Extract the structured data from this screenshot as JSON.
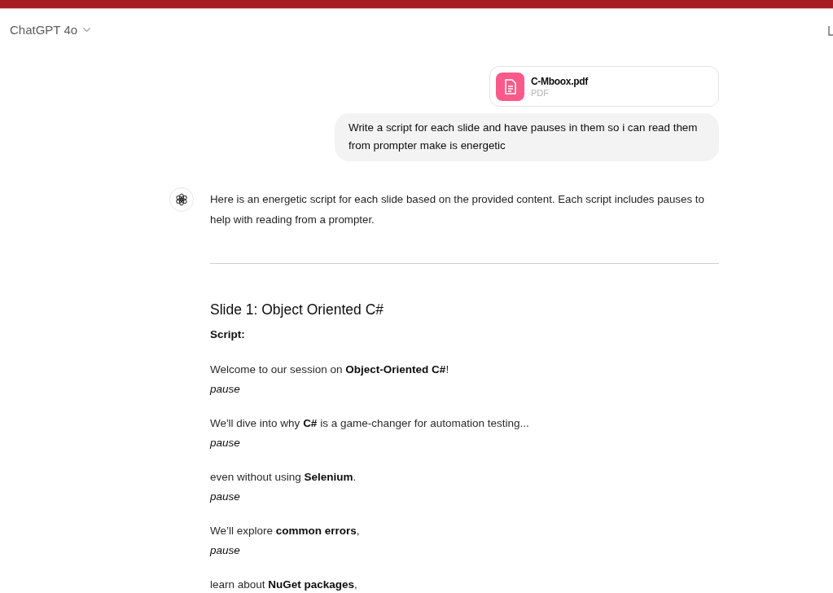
{
  "header": {
    "model_label": "ChatGPT 4o"
  },
  "user_message": {
    "attachment": {
      "file_name": "C-Mboox.pdf",
      "file_type": "PDF"
    },
    "text": "Write a script for each slide and have pauses in them so i can read them from prompter make is energetic"
  },
  "assistant_message": {
    "intro": "Here is an energetic script for each slide based on the provided content. Each script includes pauses to help with reading from a prompter.",
    "slides": [
      {
        "title": "Slide 1: Object Oriented C#",
        "label": "Script:",
        "lines": [
          {
            "text": "Welcome to our session on **Object-Oriented C#**!",
            "pause": "pause"
          },
          {
            "text": "We'll dive into why **C#** is a game-changer for automation testing...",
            "pause": "pause"
          },
          {
            "text": "even without using **Selenium**.",
            "pause": "pause"
          },
          {
            "text": "We’ll explore **common errors**,",
            "pause": "pause"
          },
          {
            "text": "learn about **NuGet packages**,"
          }
        ]
      }
    ]
  }
}
